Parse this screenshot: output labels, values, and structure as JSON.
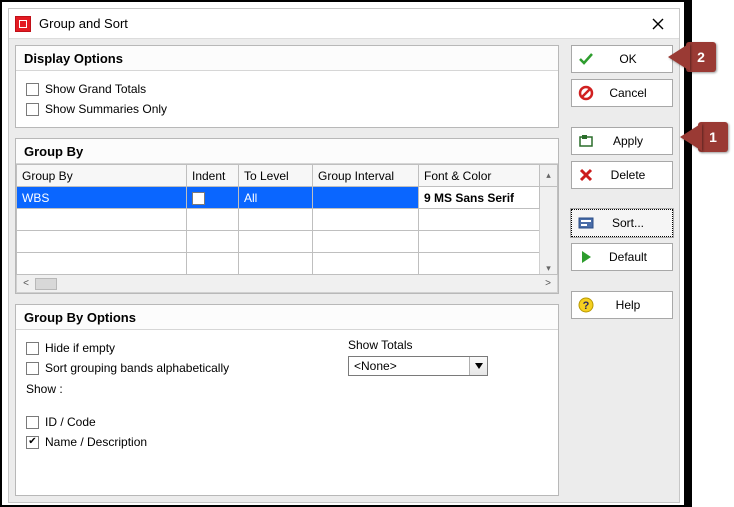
{
  "window_title": "Group and Sort",
  "display_options": {
    "header": "Display Options",
    "show_grand_totals": {
      "label": "Show Grand Totals",
      "checked": false
    },
    "show_summaries_only": {
      "label": "Show Summaries Only",
      "checked": false
    }
  },
  "group_by": {
    "header": "Group By",
    "columns": {
      "group_by": "Group By",
      "indent": "Indent",
      "to_level": "To Level",
      "group_interval": "Group Interval",
      "font_color": "Font & Color"
    },
    "rows": [
      {
        "group_by": "WBS",
        "indent": false,
        "to_level": "All",
        "group_interval": "",
        "font_color": "9 MS Sans Serif"
      }
    ]
  },
  "group_by_options": {
    "header": "Group By Options",
    "hide_if_empty": {
      "label": "Hide if empty",
      "checked": false
    },
    "sort_alpha": {
      "label": "Sort grouping bands alphabetically",
      "checked": false
    },
    "show_label": "Show :",
    "show_totals_label": "Show Totals",
    "show_totals_value": "<None>",
    "id_code": {
      "label": "ID / Code",
      "checked": false
    },
    "name_desc": {
      "label": "Name / Description",
      "checked": true
    }
  },
  "buttons": {
    "ok": "OK",
    "cancel": "Cancel",
    "apply": "Apply",
    "delete": "Delete",
    "sort": "Sort...",
    "default": "Default",
    "help": "Help"
  },
  "callouts": {
    "one": "1",
    "two": "2"
  }
}
